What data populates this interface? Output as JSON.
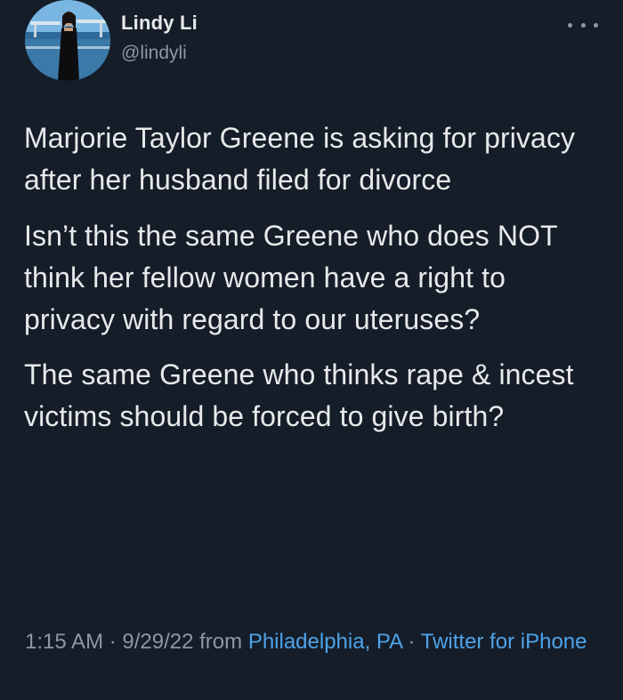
{
  "author": {
    "display_name": "Lindy Li",
    "handle": "@lindyli"
  },
  "menu": {
    "icon": "more-horizontal-icon"
  },
  "tweet": {
    "paragraphs": [
      "Marjorie Taylor Greene is asking for privacy after her husband filed for divorce",
      "Isn’t this the same Greene who does NOT think her fellow women have a right to privacy with regard to our uteruses?",
      "The same Greene who thinks rape & incest victims should be forced to give birth?"
    ]
  },
  "meta": {
    "time": "1:15 AM",
    "separator": " · ",
    "date": "9/29/22",
    "from_label": " from ",
    "location": "Philadelphia, PA",
    "source": "Twitter for iPhone"
  },
  "colors": {
    "background": "#151d29",
    "text": "#e7e9ea",
    "secondary": "#8b98a5",
    "link": "#4da3e8"
  }
}
